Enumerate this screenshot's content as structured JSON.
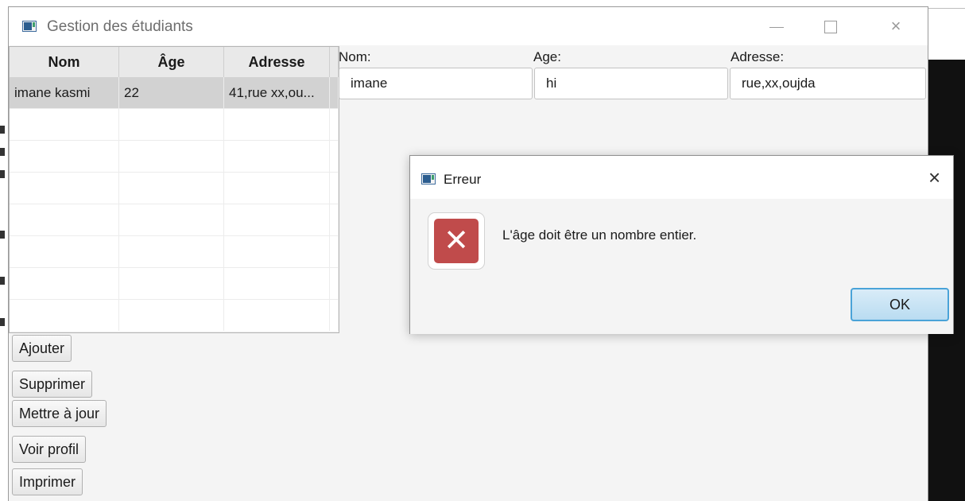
{
  "window": {
    "title": "Gestion des étudiants",
    "controls": {
      "minimize": "minimize",
      "maximize": "maximize",
      "close": "×"
    }
  },
  "table": {
    "columns": [
      "Nom",
      "Âge",
      "Adresse"
    ],
    "rows": [
      {
        "nom": "imane kasmi",
        "age": "22",
        "adresse": "41,rue xx,ou..."
      }
    ],
    "empty_rows": 7
  },
  "buttons": {
    "add": "Ajouter",
    "delete": "Supprimer",
    "update": "Mettre à jour",
    "profile": "Voir profil",
    "print": "Imprimer"
  },
  "form": {
    "nom_label": "Nom:",
    "nom_value": "imane",
    "age_label": "Age:",
    "age_value": "hi",
    "adresse_label": "Adresse:",
    "adresse_value": "rue,xx,oujda"
  },
  "dialog": {
    "title": "Erreur",
    "close": "×",
    "message": "L'âge doit être un nombre entier.",
    "ok": "OK",
    "icon": "error-icon"
  },
  "colors": {
    "error_red": "#c04b4b",
    "ok_accent": "#4aa3d8",
    "selection": "#d2d2d2"
  }
}
